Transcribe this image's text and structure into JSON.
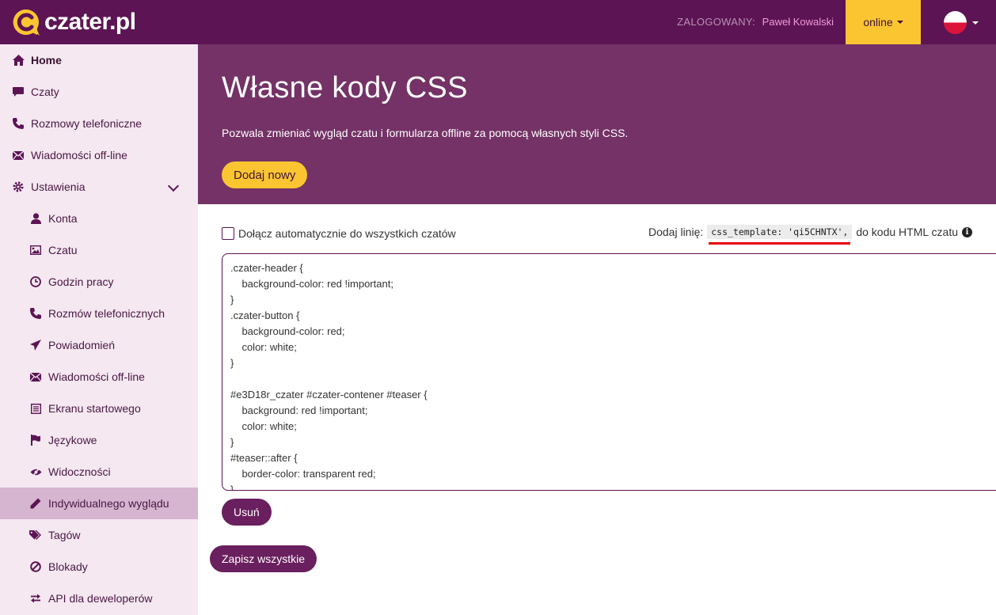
{
  "brand": {
    "name": "czater",
    "tld": ".pl"
  },
  "topbar": {
    "logged_label": "ZALOGOWANY:",
    "user_name": "Paweł Kowalski",
    "status": "online"
  },
  "sidebar": {
    "items": [
      {
        "label": "Home",
        "icon": "home-icon"
      },
      {
        "label": "Czaty",
        "icon": "chat-bubble-icon"
      },
      {
        "label": "Rozmowy telefoniczne",
        "icon": "phone-icon"
      },
      {
        "label": "Wiadomości off-line",
        "icon": "envelope-icon"
      },
      {
        "label": "Ustawienia",
        "icon": "gear-icon"
      },
      {
        "label": "Konta",
        "icon": "user-icon"
      },
      {
        "label": "Czatu",
        "icon": "image-icon"
      },
      {
        "label": "Godzin pracy",
        "icon": "clock-icon"
      },
      {
        "label": "Rozmów telefonicznych",
        "icon": "phone-icon"
      },
      {
        "label": "Powiadomień",
        "icon": "paper-plane-icon"
      },
      {
        "label": "Wiadomości off-line",
        "icon": "envelope-icon"
      },
      {
        "label": "Ekranu startowego",
        "icon": "list-icon"
      },
      {
        "label": "Językowe",
        "icon": "flag-icon"
      },
      {
        "label": "Widoczności",
        "icon": "eye-slash-icon"
      },
      {
        "label": "Indywidualnego wyglądu",
        "icon": "pencil-icon"
      },
      {
        "label": "Tagów",
        "icon": "tags-icon"
      },
      {
        "label": "Blokady",
        "icon": "ban-icon"
      },
      {
        "label": "API dla deweloperów",
        "icon": "exchange-icon"
      }
    ]
  },
  "page": {
    "title": "Własne kody CSS",
    "description": "Pozwala zmieniać wygląd czatu i formularza offline za pomocą własnych styli CSS.",
    "add_button": "Dodaj nowy"
  },
  "template": {
    "auto_attach_label": "Dołącz automatycznie do wszystkich czatów",
    "hint_prefix": "Dodaj linię:",
    "hint_code": "css_template: 'qi5CHNTX',",
    "hint_suffix": "do kodu HTML czatu",
    "css_code": ".czater-header {\n    background-color: red !important;\n}\n.czater-button {\n    background-color: red;\n    color: white;\n}\n\n#e3D18r_czater #czater-contener #teaser {\n    background: red !important;\n    color: white;\n}\n#teaser::after {\n    border-color: transparent red;\n}",
    "delete_button": "Usuń"
  },
  "save_all_button": "Zapisz wszystkie",
  "colors": {
    "primary": "#5c1454",
    "hero": "#743266",
    "accent": "#fbc531",
    "active_item": "#d5b5cf",
    "sidebar_bg": "#f5e8f1"
  }
}
